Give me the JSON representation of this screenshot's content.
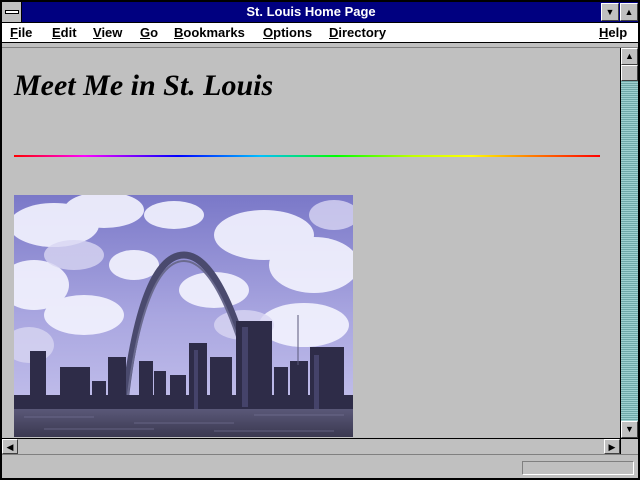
{
  "window": {
    "title": "St. Louis Home Page"
  },
  "menubar": {
    "items": [
      {
        "label": "File",
        "key": "F"
      },
      {
        "label": "Edit",
        "key": "E"
      },
      {
        "label": "View",
        "key": "V"
      },
      {
        "label": "Go",
        "key": "G"
      },
      {
        "label": "Bookmarks",
        "key": "B"
      },
      {
        "label": "Options",
        "key": "O"
      },
      {
        "label": "Directory",
        "key": "D"
      },
      {
        "label": "Help",
        "key": "H"
      }
    ]
  },
  "page": {
    "heading": "Meet Me in St. Louis"
  },
  "status": {
    "text": ""
  },
  "icons": {
    "system_menu": "system-menu-icon",
    "minimize": "triangle-down",
    "maximize": "triangle-up",
    "scroll_up": "triangle-up",
    "scroll_down": "triangle-down",
    "scroll_left": "triangle-left",
    "scroll_right": "triangle-right"
  },
  "colors": {
    "titlebar": "#000080",
    "background": "#c0c0c0",
    "scroll_track": "#7fbfbf"
  }
}
